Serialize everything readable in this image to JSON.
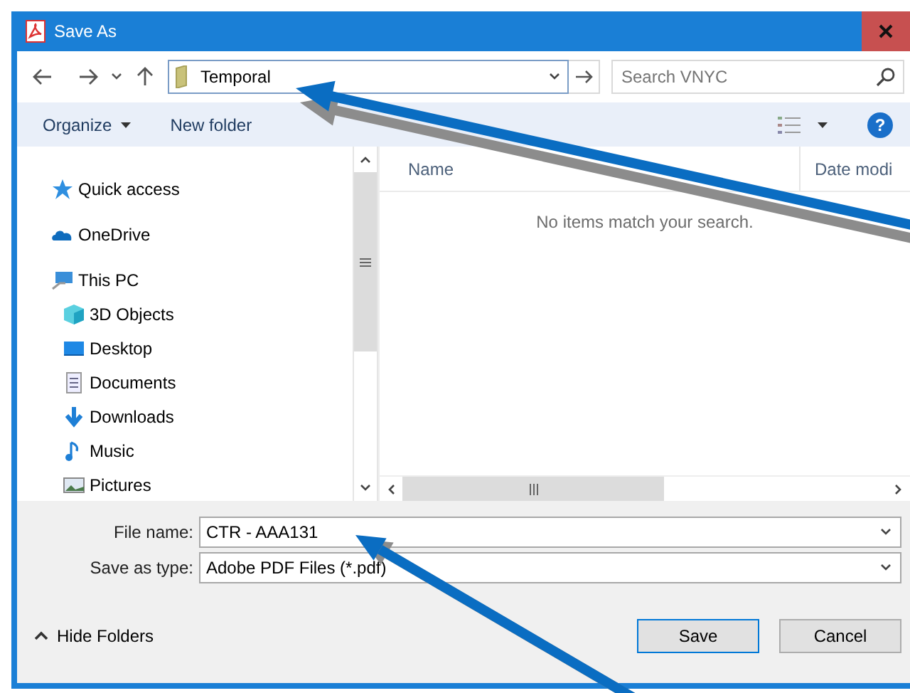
{
  "window": {
    "title": "Save As"
  },
  "address": {
    "value": "Temporal"
  },
  "search": {
    "placeholder": "Search VNYC"
  },
  "toolbar": {
    "organize": "Organize",
    "new_folder": "New folder",
    "help": "?"
  },
  "sidebar": {
    "items": [
      {
        "label": "Quick access",
        "kind": "star"
      },
      {
        "label": "OneDrive",
        "kind": "cloud"
      },
      {
        "label": "This PC",
        "kind": "computer",
        "children": [
          {
            "label": "3D Objects",
            "kind": "cube"
          },
          {
            "label": "Desktop",
            "kind": "desktop"
          },
          {
            "label": "Documents",
            "kind": "document"
          },
          {
            "label": "Downloads",
            "kind": "download"
          },
          {
            "label": "Music",
            "kind": "music"
          },
          {
            "label": "Pictures",
            "kind": "pictures"
          }
        ]
      }
    ]
  },
  "table": {
    "columns": [
      "Name",
      "Date modi"
    ],
    "empty_message": "No items match your search."
  },
  "form": {
    "file_name": {
      "label": "File name:",
      "value": "CTR - AAA131"
    },
    "save_type": {
      "label": "Save as type:",
      "value": "Adobe PDF Files (*.pdf)"
    }
  },
  "hide_folders": "Hide Folders",
  "buttons": [
    {
      "label": "Save",
      "kind": "primary"
    },
    {
      "label": "Cancel",
      "kind": "secondary"
    }
  ]
}
